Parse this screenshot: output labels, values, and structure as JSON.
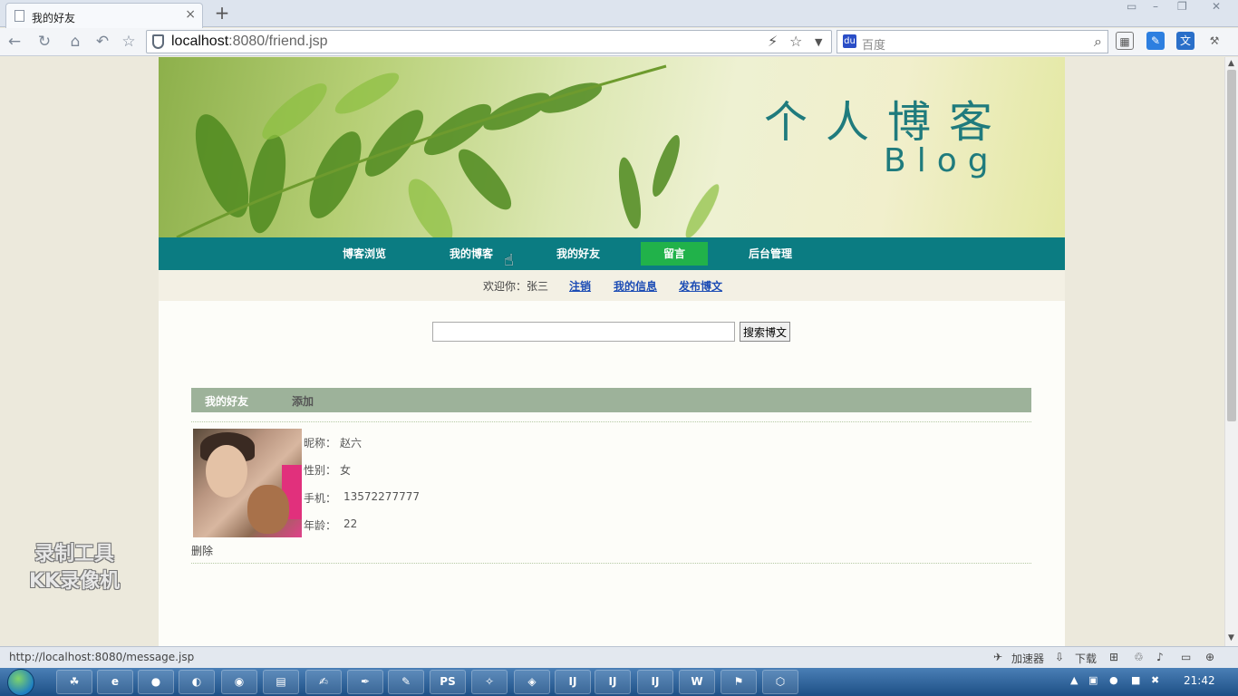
{
  "browser": {
    "tab_title": "我的好友",
    "tab_close": "×",
    "new_tab": "+",
    "url_host": "localhost",
    "url_rest": ":8080/friend.jsp",
    "search_placeholder": "百度",
    "window_controls": [
      "▭",
      "–",
      "❐",
      "✕"
    ]
  },
  "banner": {
    "title": "个人博客",
    "subtitle": "Blog"
  },
  "nav": {
    "items": [
      "博客浏览",
      "我的博客",
      "我的好友",
      "留言",
      "后台管理"
    ],
    "active_index": 3
  },
  "subbar": {
    "greeting": "欢迎你：张三",
    "links": [
      "注销",
      "我的信息",
      "发布博文"
    ]
  },
  "search": {
    "value": "",
    "button": "搜索博文"
  },
  "friends_section": {
    "title": "我的好友",
    "add": "添加",
    "friend": {
      "fields": [
        {
          "label": "昵称：",
          "value": "赵六"
        },
        {
          "label": "性别：",
          "value": "女"
        },
        {
          "label": "手机：",
          "value": "13572277777"
        },
        {
          "label": "年龄：",
          "value": "22"
        }
      ],
      "delete": "删除"
    }
  },
  "watermark": {
    "line1": "录制工具",
    "line2": "KK录像机"
  },
  "statusbar": {
    "url": "http://localhost:8080/message.jsp",
    "accelerator": "加速器",
    "download": "下载"
  },
  "taskbar": {
    "clock": "21:42",
    "buttons": [
      "PS",
      "IJ",
      "IJ",
      "IJ",
      "W"
    ]
  },
  "colors": {
    "nav_bg": "#0b7c82",
    "nav_active": "#21b24a",
    "section_head": "#9db29a",
    "link": "#1d4db5",
    "banner_text": "#1f7b7d"
  }
}
